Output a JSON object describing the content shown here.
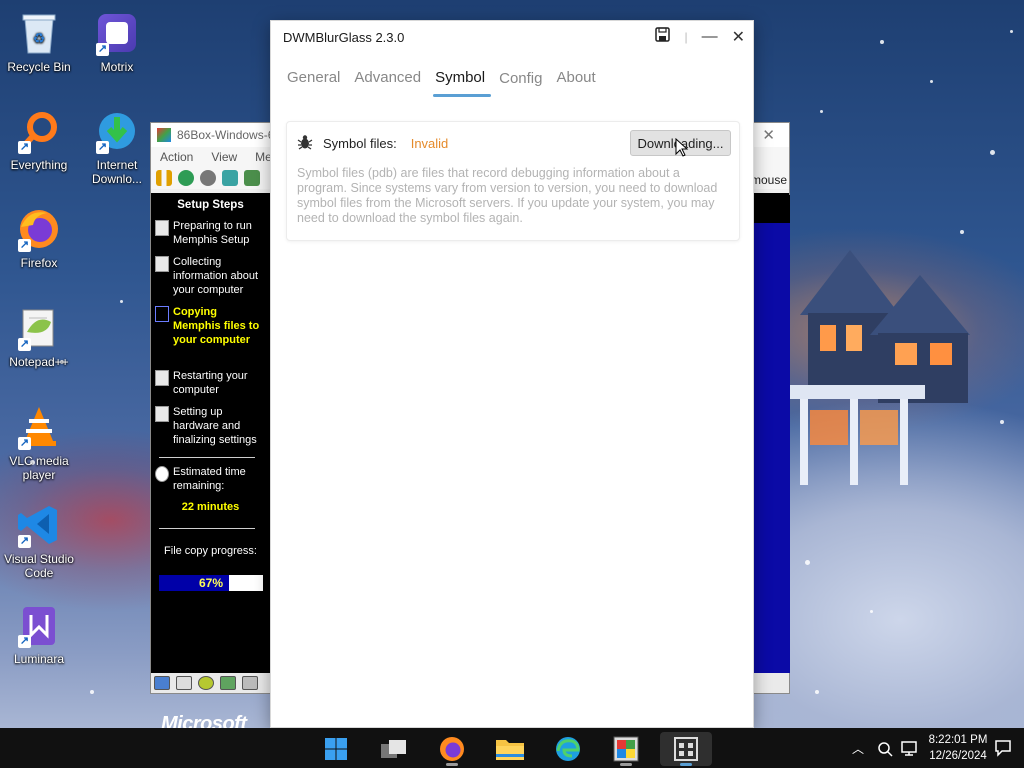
{
  "desktop": {
    "icons": [
      {
        "label": "Recycle Bin",
        "icon": "recycle-bin-icon"
      },
      {
        "label": "Motrix",
        "icon": "motrix-icon"
      },
      {
        "label": "Everything",
        "icon": "everything-search-icon"
      },
      {
        "label": "Internet Downlo...",
        "icon": "internet-download-manager-icon"
      },
      {
        "label": "Firefox",
        "icon": "firefox-icon"
      },
      {
        "label": "Notepad++",
        "icon": "notepad-plus-plus-icon"
      },
      {
        "label": "VLC media player",
        "icon": "vlc-icon"
      },
      {
        "label": "Visual Studio Code",
        "icon": "vscode-icon"
      },
      {
        "label": "Luminara",
        "icon": "luminara-icon"
      }
    ]
  },
  "box86": {
    "title": "86Box-Windows-6",
    "menu": [
      "Action",
      "View",
      "Me"
    ],
    "mouse_label": "mouse",
    "setup": {
      "title": "Setup Steps",
      "steps": [
        {
          "label": "Preparing to run Memphis Setup"
        },
        {
          "label": "Collecting information about your computer"
        },
        {
          "label": "Copying Memphis files to your computer"
        },
        {
          "label": "Restarting your computer"
        },
        {
          "label": "Setting up hardware and finalizing settings"
        }
      ],
      "time_label": "Estimated time remaining:",
      "time_value": "22 minutes",
      "progress_label": "File copy progress:",
      "progress_text": "67%",
      "progress_value": 0.67,
      "brand": "Microsoft"
    }
  },
  "dwm": {
    "title": "DWMBlurGlass 2.3.0",
    "tabs": [
      "General",
      "Advanced",
      "Symbol",
      "Config",
      "About"
    ],
    "active_tab": "Symbol",
    "symbol_label": "Symbol files:",
    "symbol_status": "Invalid",
    "download_button": "Downloading...",
    "description": "Symbol files (pdb) are files that record debugging information about a program. Since systems vary from version to version, you need to download symbol files from the Microsoft servers. If you update your system, you may need to download the symbol files again."
  },
  "taskbar": {
    "apps": [
      "start-icon",
      "task-view-icon",
      "firefox-icon",
      "file-explorer-icon",
      "edge-icon",
      "86box-icon",
      "dwmblurglass-icon"
    ],
    "time": "8:22:01 PM",
    "date": "12/26/2024"
  },
  "colors": {
    "accent": "#5a9fd4",
    "invalid": "#e58b2c",
    "progress_fill": "#0000a8",
    "setup_highlight": "#ffff00"
  }
}
